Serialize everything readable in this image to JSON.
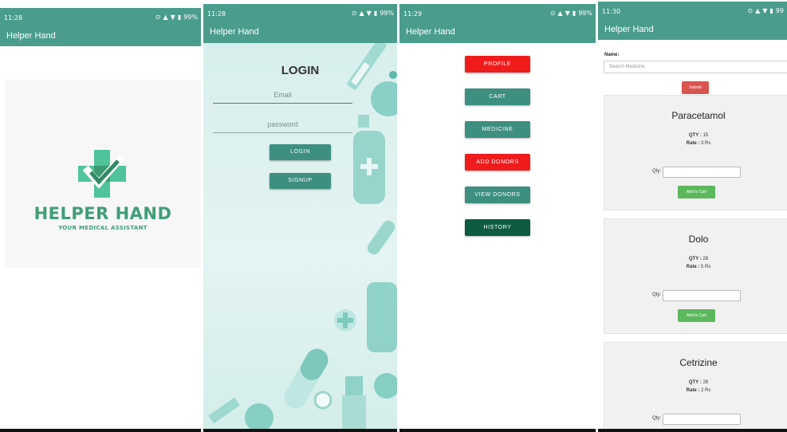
{
  "screens": [
    {
      "status": {
        "time": "11:28",
        "battery": "99%"
      },
      "title": "Helper Hand",
      "logo": {
        "name": "HELPER HAND",
        "tagline": "YOUR MEDICAL ASSISTANT"
      }
    },
    {
      "status": {
        "time": "11:28",
        "battery": "99%"
      },
      "title": "Helper Hand",
      "heading": "LOGIN",
      "email_placeholder": "Email",
      "password_placeholder": "password",
      "login_label": "LOGIN",
      "signup_label": "SIGNUP"
    },
    {
      "status": {
        "time": "11:29",
        "battery": "99%"
      },
      "title": "Helper Hand",
      "menu": [
        "PROFILE",
        "CART",
        "MEDICINE",
        "ADD DONORS",
        "VIEW DONORS",
        "HISTORY"
      ]
    },
    {
      "status": {
        "time": "11:30",
        "battery": "99"
      },
      "title": "Helper Hand",
      "name_label": "Name:",
      "search_placeholder": "Search Medicine",
      "submit_label": "Submit",
      "qty_label": "Qty:",
      "add_to_cart": "Add to Cart",
      "medicines": [
        {
          "name": "Paracetamol",
          "qty_key": "QTY :",
          "qty": "15",
          "rate_key": "Rate :",
          "rate": "3 Rs"
        },
        {
          "name": "Dolo",
          "qty_key": "QTY :",
          "qty": "28",
          "rate_key": "Rate :",
          "rate": "5 Rs"
        },
        {
          "name": "Cetrizine",
          "qty_key": "QTY :",
          "qty": "28",
          "rate_key": "Rate :",
          "rate": "2 Rs"
        }
      ]
    }
  ],
  "colors": {
    "appbar": "#4a9d8c",
    "accent_red": "#f01c1c",
    "accent_teal": "#3d8f80",
    "accent_dark": "#0d5c3f",
    "logo_green": "#3f9e77",
    "cart_green": "#5cb85c",
    "submit_red": "#d9534f"
  },
  "icons": [
    "wifi-icon",
    "signal-icon",
    "battery-icon",
    "alarm-icon"
  ]
}
